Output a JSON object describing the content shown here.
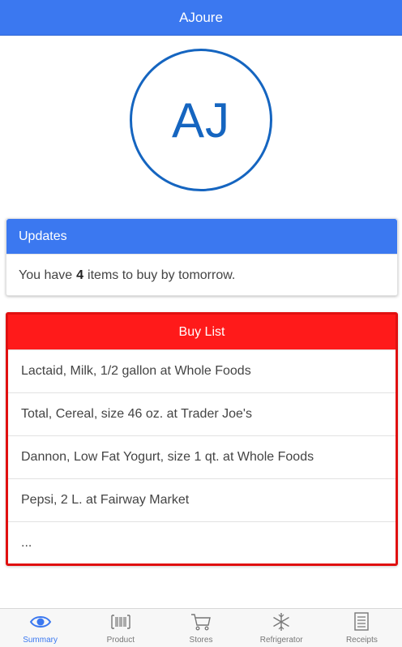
{
  "header": {
    "title": "AJoure"
  },
  "avatar": {
    "initials": "AJ"
  },
  "updates": {
    "title": "Updates",
    "message_prefix": "You have",
    "count": "4",
    "message_suffix": "items to buy by tomorrow."
  },
  "buy_list": {
    "title": "Buy List",
    "items": [
      {
        "text": "Lactaid, Milk, 1/2 gallon at Whole Foods"
      },
      {
        "text": "Total, Cereal, size 46 oz. at Trader Joe's"
      },
      {
        "text": "Dannon, Low Fat Yogurt, size 1 qt. at Whole Foods"
      },
      {
        "text": "Pepsi, 2 L. at Fairway Market"
      },
      {
        "text": "..."
      }
    ]
  },
  "tabs": [
    {
      "label": "Summary",
      "icon": "eye-icon",
      "active": true
    },
    {
      "label": "Product",
      "icon": "barcode-icon",
      "active": false
    },
    {
      "label": "Stores",
      "icon": "cart-icon",
      "active": false
    },
    {
      "label": "Refrigerator",
      "icon": "snowflake-icon",
      "active": false
    },
    {
      "label": "Receipts",
      "icon": "receipt-icon",
      "active": false
    }
  ],
  "colors": {
    "primary": "#3b78f0",
    "buy_list": "#ff1a1a",
    "avatar": "#1565c0"
  }
}
